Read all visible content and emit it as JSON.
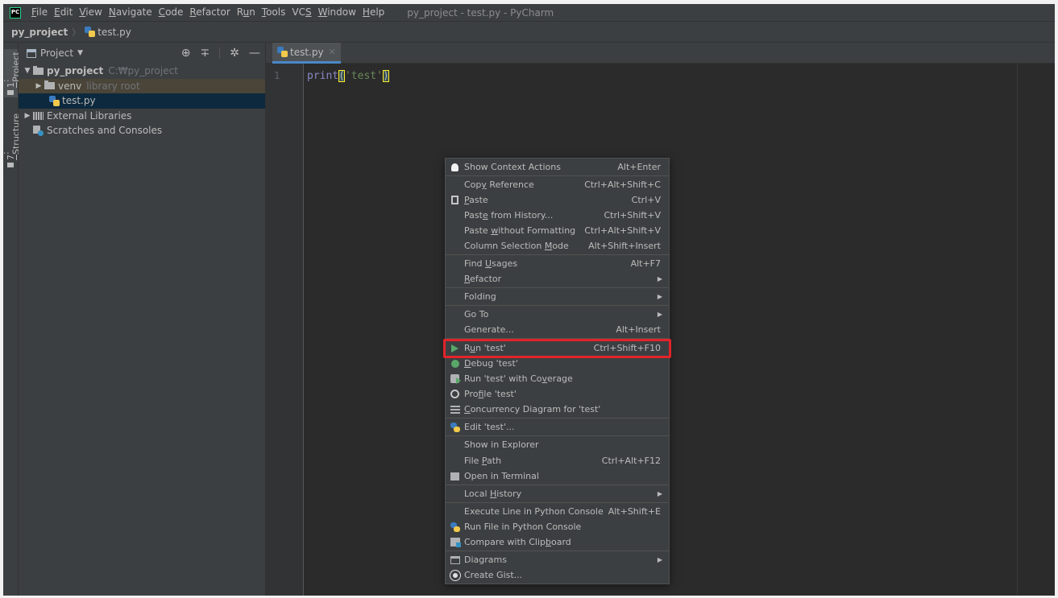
{
  "menubar": {
    "logo": "PC",
    "items": [
      {
        "u": "F",
        "rest": "ile"
      },
      {
        "u": "E",
        "rest": "dit"
      },
      {
        "u": "V",
        "rest": "iew"
      },
      {
        "u": "N",
        "rest": "avigate"
      },
      {
        "u": "C",
        "rest": "ode"
      },
      {
        "u": "R",
        "rest": "efactor"
      },
      {
        "pre": "R",
        "u": "u",
        "rest": "n"
      },
      {
        "u": "T",
        "rest": "ools"
      },
      {
        "pre": "VC",
        "u": "S",
        "rest": ""
      },
      {
        "u": "W",
        "rest": "indow"
      },
      {
        "u": "H",
        "rest": "elp"
      }
    ],
    "window_title": "py_project - test.py - PyCharm"
  },
  "breadcrumb": {
    "project": "py_project",
    "separator": "〉",
    "file": "test.py"
  },
  "toolstrip": {
    "project_tab_prefix": "1",
    "project_tab_label": ": Project",
    "structure_tab_prefix": "7",
    "structure_tab_label": ": Structure"
  },
  "project_panel": {
    "title": "Project",
    "tree": {
      "root_name": "py_project",
      "root_path": "C:₩py_project",
      "venv_name": "venv",
      "venv_note": "library root",
      "file_name": "test.py",
      "external_libraries": "External Libraries",
      "scratches": "Scratches and Consoles"
    }
  },
  "editor": {
    "tab_label": "test.py",
    "line_number": "1",
    "code": {
      "func": "print",
      "open": "(",
      "string": "'test'",
      "close": ")"
    }
  },
  "context_menu": {
    "show_context_actions": {
      "label": "Show Context Actions",
      "shortcut": "Alt+Enter"
    },
    "copy_reference": {
      "pre": "Cop",
      "u": "y",
      "rest": " Reference",
      "shortcut": "Ctrl+Alt+Shift+C"
    },
    "paste": {
      "pre": "",
      "u": "P",
      "rest": "aste",
      "shortcut": "Ctrl+V"
    },
    "paste_history": {
      "pre": "Past",
      "u": "e",
      "rest": " from History...",
      "shortcut": "Ctrl+Shift+V"
    },
    "paste_plain": {
      "pre": "Paste ",
      "u": "w",
      "rest": "ithout Formatting",
      "shortcut": "Ctrl+Alt+Shift+V"
    },
    "column_selection": {
      "pre": "Column Selection ",
      "u": "M",
      "rest": "ode",
      "shortcut": "Alt+Shift+Insert"
    },
    "find_usages": {
      "pre": "Find ",
      "u": "U",
      "rest": "sages",
      "shortcut": "Alt+F7"
    },
    "refactor": {
      "pre": "",
      "u": "R",
      "rest": "efactor"
    },
    "folding": {
      "label": "Folding"
    },
    "goto": {
      "label": "Go To"
    },
    "generate": {
      "label": "Generate...",
      "shortcut": "Alt+Insert"
    },
    "run": {
      "pre": "R",
      "u": "u",
      "rest": "n 'test'",
      "shortcut": "Ctrl+Shift+F10"
    },
    "debug": {
      "pre": "",
      "u": "D",
      "rest": "ebug 'test'"
    },
    "run_coverage": {
      "pre": "Run 'test' with Co",
      "u": "v",
      "rest": "erage"
    },
    "profile": {
      "pre": "Pro",
      "u": "f",
      "rest": "ile 'test'"
    },
    "concurrency": {
      "pre": "",
      "u": "C",
      "rest": "oncurrency Diagram for 'test'"
    },
    "edit_config": {
      "label": "Edit 'test'..."
    },
    "show_explorer": {
      "label": "Show in Explorer"
    },
    "file_path": {
      "pre": "File ",
      "u": "P",
      "rest": "ath",
      "shortcut": "Ctrl+Alt+F12"
    },
    "open_terminal": {
      "label": "Open in Terminal"
    },
    "local_history": {
      "pre": "Local ",
      "u": "H",
      "rest": "istory"
    },
    "execute_line": {
      "label": "Execute Line in Python Console",
      "shortcut": "Alt+Shift+E"
    },
    "run_file_console": {
      "label": "Run File in Python Console"
    },
    "compare_clipboard": {
      "pre": "Compare with Clip",
      "u": "b",
      "rest": "oard"
    },
    "diagrams": {
      "label": "Diagrams"
    },
    "create_gist": {
      "label": "Create Gist..."
    }
  },
  "colors": {
    "highlight_box": "#e2232a",
    "menu_bg": "#3c3f41",
    "editor_bg": "#2b2b2b",
    "selection": "#4b6eaf"
  }
}
